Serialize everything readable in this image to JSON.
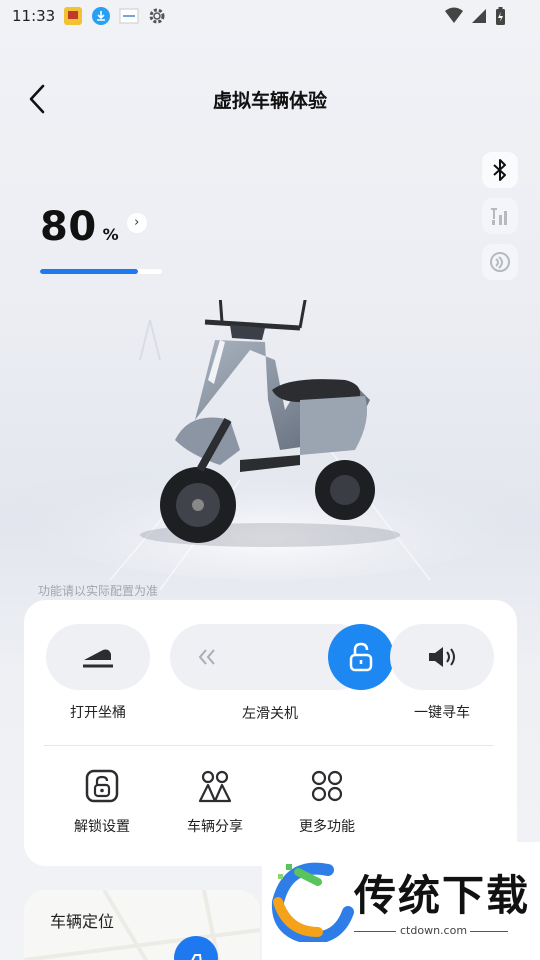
{
  "status_bar": {
    "time": "11:33"
  },
  "header": {
    "title": "虚拟车辆体验"
  },
  "battery": {
    "value": "80",
    "unit": "%",
    "level": 0.8
  },
  "disclaimer": "功能请以实际配置为准",
  "controls": {
    "seat_label": "打开坐桶",
    "slide_label": "左滑关机",
    "find_label": "一键寻车",
    "unlock_settings_label": "解锁设置",
    "share_label": "车辆分享",
    "more_label": "更多功能"
  },
  "map_card": {
    "title": "车辆定位"
  },
  "watermark": {
    "text": "传统下载",
    "url": "ctdown.com"
  },
  "colors": {
    "accent": "#1e78f0",
    "card": "#ffffff",
    "pill": "#eef0f4"
  }
}
